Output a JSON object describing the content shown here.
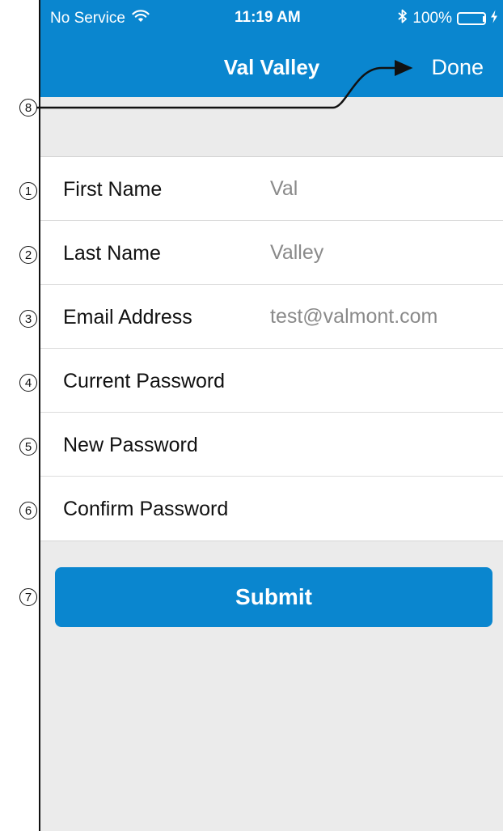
{
  "statusbar": {
    "carrier": "No Service",
    "time": "11:19 AM",
    "battery": "100%",
    "icons": [
      "wifi-icon",
      "bluetooth-icon",
      "battery-icon",
      "charging-icon"
    ],
    "battery_level": 1.0
  },
  "navbar": {
    "title": "Val Valley",
    "done_label": "Done"
  },
  "form": {
    "rows": [
      {
        "label": "First Name",
        "value": "Val"
      },
      {
        "label": "Last Name",
        "value": "Valley"
      },
      {
        "label": "Email Address",
        "value": "test@valmont.com"
      },
      {
        "label": "Current Password",
        "value": ""
      },
      {
        "label": "New Password",
        "value": ""
      },
      {
        "label": "Confirm Password",
        "value": ""
      }
    ]
  },
  "submit_label": "Submit",
  "callouts": [
    "1",
    "2",
    "3",
    "4",
    "5",
    "6",
    "7",
    "8"
  ],
  "colors": {
    "accent": "#0a86cf",
    "background": "#ebebeb",
    "battery": "#39d353"
  }
}
